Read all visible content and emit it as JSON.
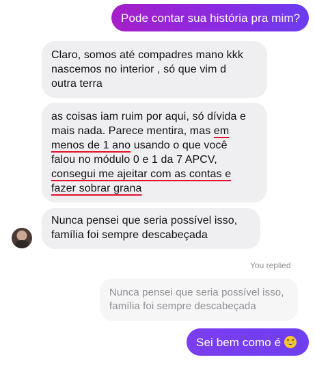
{
  "messages": {
    "m1": "Pode contar sua história pra mim?",
    "m2_line1": "Claro, somos até compadres mano kkk",
    "m2_line2": "nascemos no interior , só que vim d",
    "m2_line3": "outra terra",
    "m3_line1": "as coisas iam ruim por aqui, só dívida e",
    "m3_line2_a": "mais nada. Parece mentira, mas ",
    "m3_line2_b": "em",
    "m3_line3_a": "menos de 1 ano",
    "m3_line3_b": " usando o que você",
    "m3_line4": "falou no módulo 0 e 1 da 7 APCV,",
    "m3_line5": "consegui me ajeitar com as contas e",
    "m3_line6": "fazer sobrar grana",
    "m4_line1": "Nunca pensei que seria possível isso,",
    "m4_line2": "família foi sempre descabeçada",
    "replied_label": "You replied",
    "quote_line1": "Nunca pensei que seria possível isso,",
    "quote_line2": "família foi sempre descabeçada",
    "m5": "Sei bem como é"
  },
  "icons": {
    "avatar": "contact-avatar",
    "emoji": "grinning-sweat-emoji"
  },
  "colors": {
    "sent_start": "#a51fc8",
    "sent_end": "#6b3df0",
    "received_bg": "#efeff1",
    "underline": "#e3102b"
  }
}
